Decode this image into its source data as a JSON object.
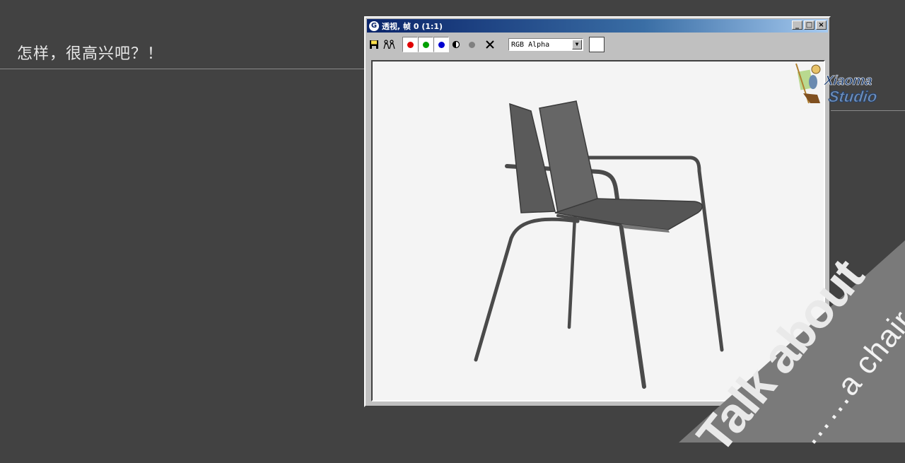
{
  "slide": {
    "title": "怎样，很高兴吧？！"
  },
  "window": {
    "title": "透视, 帧 0 (1:1)",
    "app_icon": "3dsmax-logo-icon",
    "controls": [
      "minimize",
      "maximize",
      "close"
    ]
  },
  "toolbar": {
    "save_icon": "save-icon",
    "clone_icon": "clone-icon",
    "red_channel_color": "#e00000",
    "green_channel_color": "#00a000",
    "blue_channel_color": "#0000d0",
    "channel_select_value": "RGB Alpha"
  },
  "logo": {
    "line1": "Xiaoma",
    "line2": "Studio"
  },
  "corner_text": {
    "big": "Talk about",
    "small": "……a chair"
  },
  "colors": {
    "background": "#424242",
    "titlebar_start": "#0a246a",
    "titlebar_end": "#a6caf0"
  }
}
